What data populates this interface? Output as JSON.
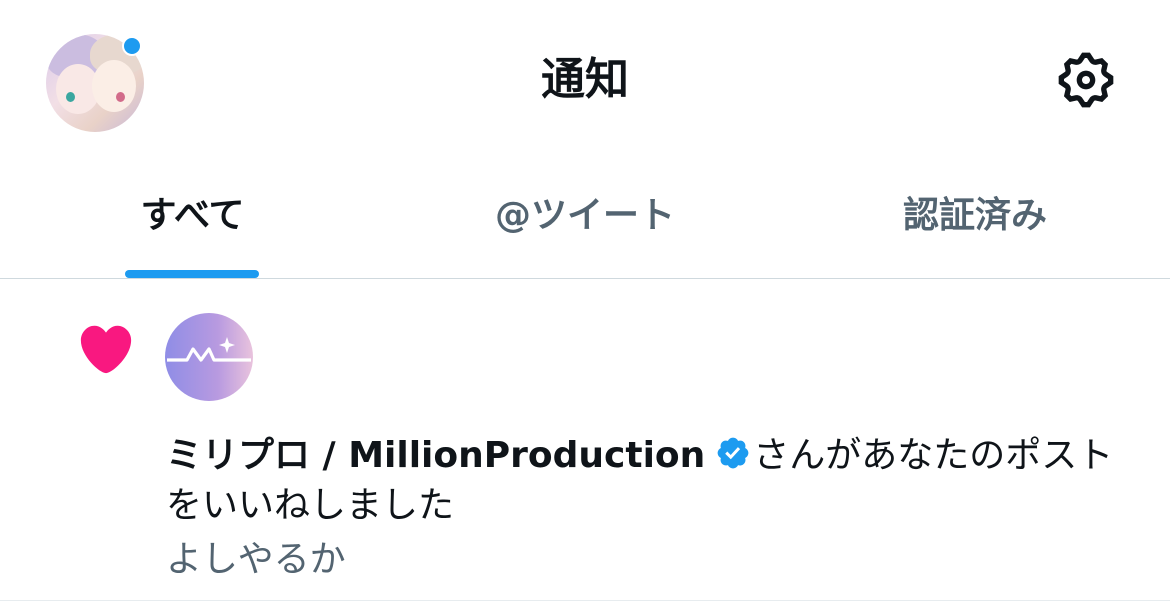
{
  "header": {
    "title": "通知",
    "settings_icon": "gear-icon",
    "has_unread_indicator": true
  },
  "tabs": [
    {
      "label": "すべて",
      "active": true
    },
    {
      "label": "@ツイート",
      "active": false
    },
    {
      "label": "認証済み",
      "active": false
    }
  ],
  "notifications": [
    {
      "type_icon": "heart-icon",
      "sender": "ミリプロ / MillionProduction",
      "verified": true,
      "action": "さんがあなたのポストをいいねしました",
      "preview": "よしやるか"
    }
  ],
  "colors": {
    "accent": "#1d9bf0",
    "like": "#f91880",
    "text_primary": "#0f1419",
    "text_secondary": "#536471"
  }
}
